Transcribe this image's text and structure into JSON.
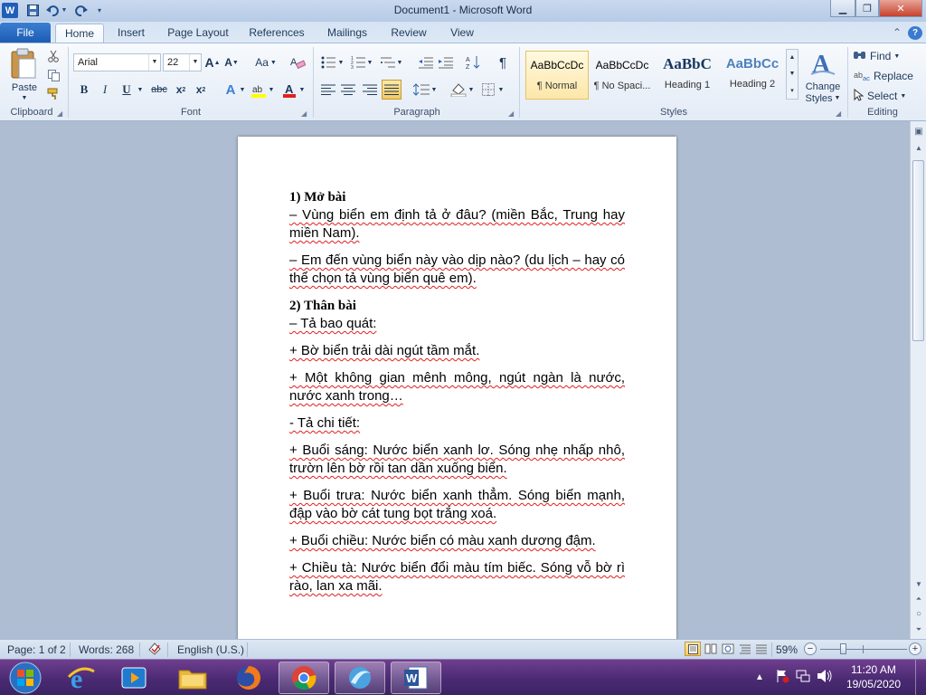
{
  "window": {
    "title": "Document1  -  Microsoft Word"
  },
  "tabs": [
    "File",
    "Home",
    "Insert",
    "Page Layout",
    "References",
    "Mailings",
    "Review",
    "View"
  ],
  "clipboard": {
    "paste_label": "Paste",
    "group_label": "Clipboard"
  },
  "font": {
    "name": "Arial",
    "size": "22",
    "group_label": "Font",
    "case_label": "Aa"
  },
  "paragraph": {
    "group_label": "Paragraph"
  },
  "styles": {
    "group_label": "Styles",
    "items": [
      {
        "preview": "AaBbCcDc",
        "name": "¶ Normal"
      },
      {
        "preview": "AaBbCcDc",
        "name": "¶ No Spaci..."
      },
      {
        "preview": "AaBbC",
        "name": "Heading 1"
      },
      {
        "preview": "AaBbCc",
        "name": "Heading 2"
      }
    ],
    "change_label_1": "Change",
    "change_label_2": "Styles"
  },
  "editing": {
    "group_label": "Editing",
    "find": "Find",
    "replace": "Replace",
    "select": "Select"
  },
  "document": {
    "paragraphs": [
      {
        "type": "heading",
        "text": "1) Mở bài"
      },
      {
        "type": "body-tight",
        "text": "– Vùng biển em định tả ở đâu? (miền Bắc, Trung hay miền Nam)."
      },
      {
        "type": "body",
        "text": "– Em đến vùng biển này vào dịp nào? (du lịch – hay có thể chọn tả vùng biển quê em)."
      },
      {
        "type": "heading",
        "text": "2) Thân bài"
      },
      {
        "type": "body",
        "text": "– Tả bao quát:"
      },
      {
        "type": "body",
        "text": "+ Bờ biển trải dài ngút tầm mắt."
      },
      {
        "type": "body",
        "text": "+ Một không gian mênh mông, ngút ngàn là nước, nước xanh trong…"
      },
      {
        "type": "body",
        "text": "- Tả chi tiết:"
      },
      {
        "type": "body",
        "text": "+ Buổi sáng: Nước biển xanh lơ. Sóng nhẹ nhấp nhô, trườn lên bờ rồi tan dần xuống biển."
      },
      {
        "type": "body",
        "text": "+ Buổi trưa: Nước biển xanh thẳm. Sóng biển mạnh, đập vào bờ cát tung bọt trắng xoá."
      },
      {
        "type": "body",
        "text": "+ Buổi chiều: Nước biển có màu xanh dương đậm."
      },
      {
        "type": "body",
        "text": "+ Chiều tà: Nước biển đổi màu tím biếc. Sóng vỗ bờ rì rào, lan xa mãi."
      }
    ]
  },
  "status": {
    "page": "Page: 1 of 2",
    "words": "Words: 268",
    "language": "English (U.S.)",
    "zoom": "59%"
  },
  "taskbar": {
    "time": "11:20 AM",
    "date": "19/05/2020"
  },
  "colors": {
    "file_tab": "#1c5cb4",
    "taskbar": "#4b2a73",
    "ribbon": "#e3ebf6"
  }
}
